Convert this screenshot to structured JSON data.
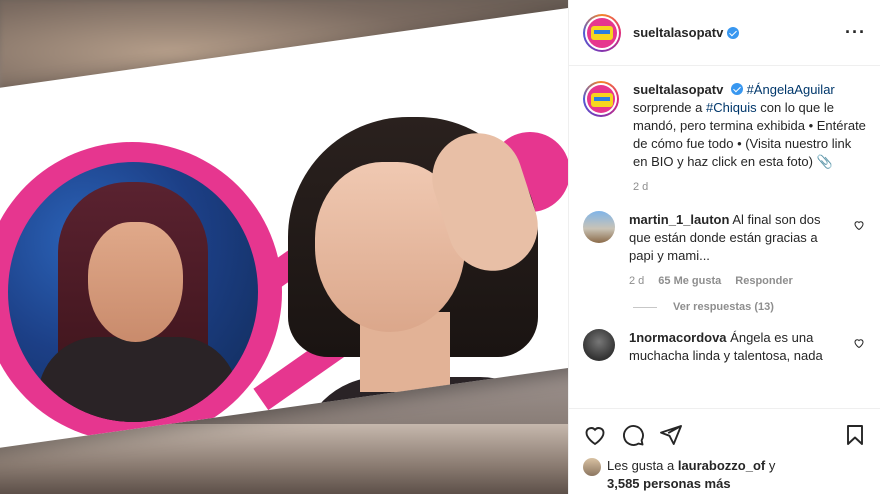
{
  "post": {
    "username": "sueltalasopatv",
    "more_label": "···"
  },
  "caption": {
    "username": "sueltalasopatv",
    "hashtag1": "#ÁngelaAguilar",
    "text1": "sorprende a",
    "hashtag2": "#Chiquis",
    "text2": "con lo que le mandó, pero termina exhibida • Entérate de cómo fue todo • (Visita nuestro link en BIO y haz click en esta foto) 📎",
    "time": "2 d"
  },
  "comments": [
    {
      "username": "martin_1_lauton",
      "text": "Al final son dos que están donde están gracias a papi y mami...",
      "time": "2 d",
      "likes": "65 Me gusta",
      "reply": "Responder",
      "view_replies": "Ver respuestas (13)"
    },
    {
      "username": "1normacordova",
      "text": "Ángela es una muchacha linda y talentosa, nada"
    }
  ],
  "likes": {
    "prefix": "Les gusta a",
    "user": "laurabozzo_of",
    "and": "y",
    "count": "3,585 personas más"
  },
  "icons": [
    "heart-icon",
    "comment-icon",
    "share-icon",
    "bookmark-icon",
    "more-icon",
    "verified-icon"
  ],
  "colors": {
    "accent_pink": "#e6368f",
    "link": "#00376b",
    "verified": "#3897f0"
  }
}
